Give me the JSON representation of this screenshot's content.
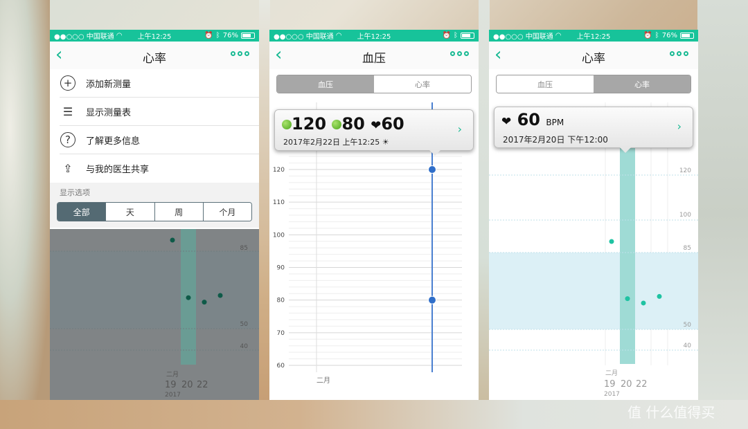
{
  "status": {
    "carrier": "●●○○○ 中国联通",
    "time": "上午12:25",
    "battery": "76%",
    "battery_level": 0.76
  },
  "colors": {
    "accent": "#17c39a",
    "segment_active": "#546a73"
  },
  "phone1": {
    "title": "心率",
    "menu": [
      {
        "label": "添加新测量",
        "icon": "plus-circle-icon"
      },
      {
        "label": "显示测量表",
        "icon": "list-icon"
      },
      {
        "label": "了解更多信息",
        "icon": "help-circle-icon"
      },
      {
        "label": "与我的医生共享",
        "icon": "share-icon"
      }
    ],
    "display_options_label": "显示选项",
    "segments": [
      "全部",
      "天",
      "周",
      "个月"
    ],
    "active_segment": 0,
    "chart": {
      "y_labels": [
        "85",
        "50",
        "40"
      ],
      "month_label": "二月",
      "day_labels": [
        "19",
        "20",
        "22"
      ],
      "year_label": "2017"
    }
  },
  "phone2": {
    "title": "血压",
    "tabs": [
      "血压",
      "心率"
    ],
    "active_tab": 0,
    "popup": {
      "systolic": "120",
      "diastolic": "80",
      "pulse": "60",
      "datetime": "2017年2月22日 上午12:25",
      "weather_icon": "☀"
    },
    "chart": {
      "y_labels": [
        "120",
        "110",
        "100",
        "90",
        "80",
        "70",
        "60"
      ],
      "month_label": "二月"
    }
  },
  "phone3": {
    "title": "心率",
    "tabs": [
      "血压",
      "心率"
    ],
    "active_tab": 1,
    "popup": {
      "value": "60",
      "unit": "BPM",
      "datetime": "2017年2月20日 下午12:00"
    },
    "chart": {
      "y_labels": [
        "120",
        "100",
        "85",
        "50",
        "40"
      ],
      "month_label": "二月",
      "day_labels": [
        "19",
        "20",
        "22"
      ],
      "year_label": "2017"
    }
  },
  "chart_data": [
    {
      "type": "scatter",
      "title": "心率",
      "xlabel": "二月 2017",
      "ylabel": "",
      "x": [
        "19",
        "20",
        "21",
        "22"
      ],
      "y": [
        90,
        64,
        62,
        65
      ],
      "ylim": [
        35,
        130
      ]
    },
    {
      "type": "scatter",
      "title": "血压",
      "xlabel": "二月",
      "series": [
        {
          "name": "120",
          "x": [
            "22"
          ],
          "values": [
            120
          ]
        },
        {
          "name": "80",
          "x": [
            "22"
          ],
          "values": [
            80
          ]
        }
      ],
      "ylim": [
        60,
        125
      ]
    }
  ],
  "watermark": "值 什么值得买"
}
